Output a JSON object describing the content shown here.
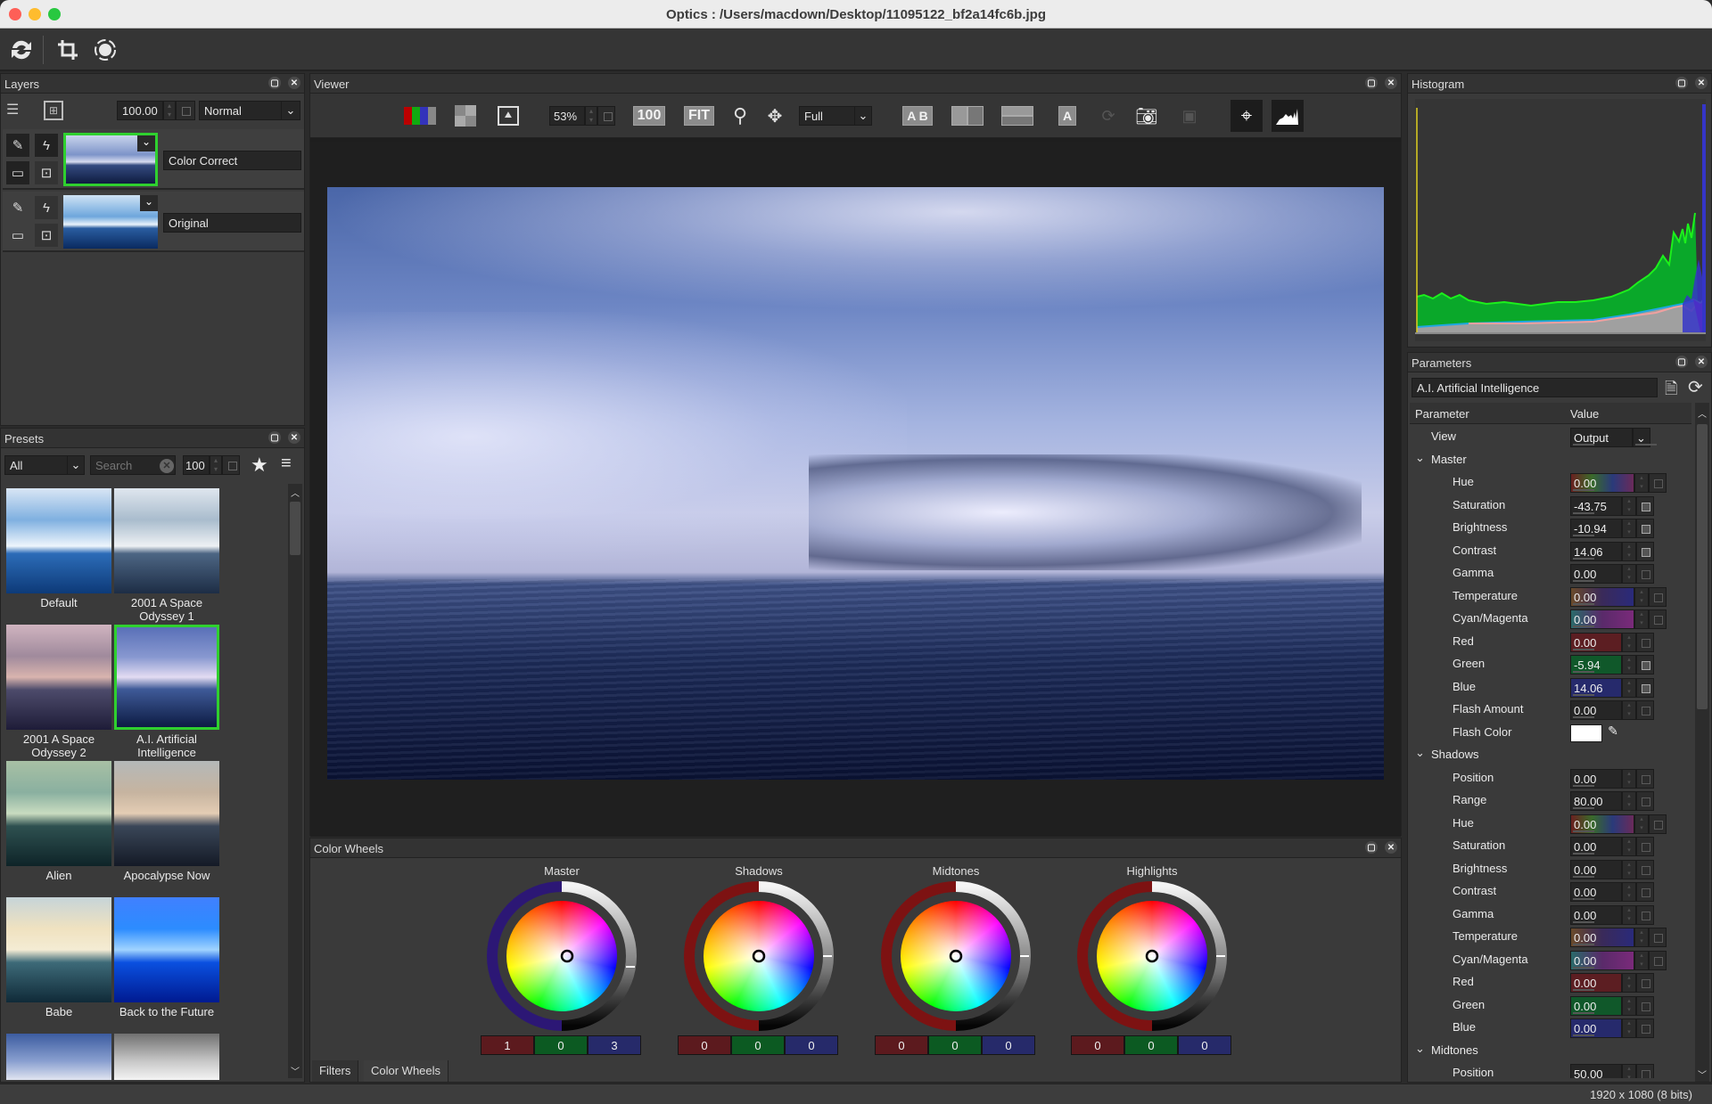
{
  "window": {
    "title": "Optics : /Users/macdown/Desktop/11095122_bf2a14fc6b.jpg",
    "traffic_lights": [
      "close",
      "minimize",
      "zoom"
    ]
  },
  "main_toolbar": {
    "icons": [
      "refresh-icon",
      "crop-icon",
      "transform-icon"
    ]
  },
  "layers": {
    "title": "Layers",
    "opacity": "100.00",
    "blend_mode": "Normal",
    "items": [
      {
        "name": "Color Correct",
        "selected": true
      },
      {
        "name": "Original",
        "selected": false
      }
    ]
  },
  "presets": {
    "title": "Presets",
    "category": "All",
    "search_placeholder": "Search",
    "size": "100",
    "items": [
      {
        "name": "Default",
        "selected": false
      },
      {
        "name": "2001 A Space Odyssey 1",
        "selected": false
      },
      {
        "name": "2001 A Space Odyssey 2",
        "selected": false
      },
      {
        "name": "A.I. Artificial Intelligence",
        "selected": true
      },
      {
        "name": "Alien",
        "selected": false
      },
      {
        "name": "Apocalypse Now",
        "selected": false
      },
      {
        "name": "Babe",
        "selected": false
      },
      {
        "name": "Back to the Future",
        "selected": false
      }
    ]
  },
  "viewer": {
    "title": "Viewer",
    "zoom": "53%",
    "btn_100": "100",
    "btn_fit": "FIT",
    "quality": "Full",
    "ab_label": "A B",
    "a_label": "A"
  },
  "color_wheels": {
    "title": "Color Wheels",
    "wheels": [
      {
        "label": "Master",
        "r": "1",
        "g": "0",
        "b": "3"
      },
      {
        "label": "Shadows",
        "r": "0",
        "g": "0",
        "b": "0"
      },
      {
        "label": "Midtones",
        "r": "0",
        "g": "0",
        "b": "0"
      },
      {
        "label": "Highlights",
        "r": "0",
        "g": "0",
        "b": "0"
      }
    ],
    "tabs": [
      {
        "label": "Filters",
        "active": false
      },
      {
        "label": "Color Wheels",
        "active": true
      }
    ]
  },
  "histogram": {
    "title": "Histogram"
  },
  "parameters": {
    "title": "Parameters",
    "preset_name": "A.I. Artificial Intelligence",
    "col_parameter": "Parameter",
    "col_value": "Value",
    "view_label": "View",
    "view_value": "Output",
    "groups": [
      {
        "name": "Master",
        "rows": [
          {
            "label": "Hue",
            "value": "0.00",
            "kind": "hue"
          },
          {
            "label": "Saturation",
            "value": "-43.75",
            "kind": "plain",
            "changed": true
          },
          {
            "label": "Brightness",
            "value": "-10.94",
            "kind": "plain",
            "changed": true
          },
          {
            "label": "Contrast",
            "value": "14.06",
            "kind": "plain",
            "changed": true
          },
          {
            "label": "Gamma",
            "value": "0.00",
            "kind": "plain"
          },
          {
            "label": "Temperature",
            "value": "0.00",
            "kind": "temp"
          },
          {
            "label": "Cyan/Magenta",
            "value": "0.00",
            "kind": "cm"
          },
          {
            "label": "Red",
            "value": "0.00",
            "kind": "red"
          },
          {
            "label": "Green",
            "value": "-5.94",
            "kind": "green",
            "changed": true
          },
          {
            "label": "Blue",
            "value": "14.06",
            "kind": "blue",
            "changed": true
          },
          {
            "label": "Flash Amount",
            "value": "0.00",
            "kind": "plain"
          },
          {
            "label": "Flash Color",
            "value": "",
            "kind": "color"
          }
        ]
      },
      {
        "name": "Shadows",
        "rows": [
          {
            "label": "Position",
            "value": "0.00",
            "kind": "plain"
          },
          {
            "label": "Range",
            "value": "80.00",
            "kind": "plain"
          },
          {
            "label": "Hue",
            "value": "0.00",
            "kind": "hue"
          },
          {
            "label": "Saturation",
            "value": "0.00",
            "kind": "plain"
          },
          {
            "label": "Brightness",
            "value": "0.00",
            "kind": "plain"
          },
          {
            "label": "Contrast",
            "value": "0.00",
            "kind": "plain"
          },
          {
            "label": "Gamma",
            "value": "0.00",
            "kind": "plain"
          },
          {
            "label": "Temperature",
            "value": "0.00",
            "kind": "temp"
          },
          {
            "label": "Cyan/Magenta",
            "value": "0.00",
            "kind": "cm"
          },
          {
            "label": "Red",
            "value": "0.00",
            "kind": "red"
          },
          {
            "label": "Green",
            "value": "0.00",
            "kind": "green"
          },
          {
            "label": "Blue",
            "value": "0.00",
            "kind": "blue"
          }
        ]
      },
      {
        "name": "Midtones",
        "rows": [
          {
            "label": "Position",
            "value": "50.00",
            "kind": "plain"
          }
        ]
      }
    ]
  },
  "status": {
    "image_info": "1920 x 1080 (8 bits)"
  },
  "colors": {
    "selection_green": "#2fd02f",
    "panel_bg": "#3a3a3a",
    "field_bg": "#262626"
  }
}
